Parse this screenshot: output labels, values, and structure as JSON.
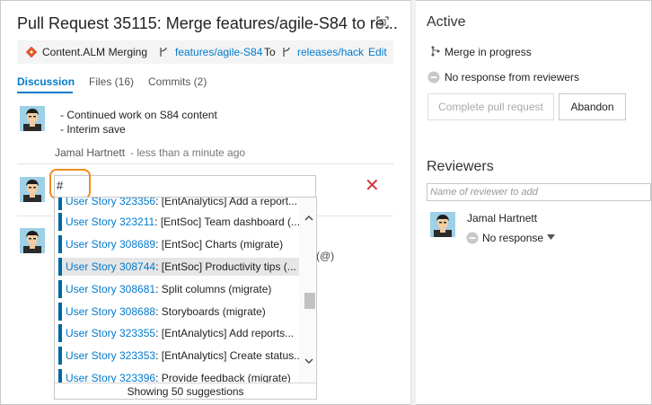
{
  "header": {
    "title": "Pull Request 35115: Merge features/agile-S84 to re...",
    "repo": "Content.ALM",
    "merging_label": ": Merging",
    "source_branch": "features/agile-S84",
    "to_label": "To",
    "target_branch": "releases/hack",
    "edit_label": "Edit"
  },
  "tabs": [
    {
      "label": "Discussion"
    },
    {
      "label": "Files (16)"
    },
    {
      "label": "Commits (2)"
    }
  ],
  "comment": {
    "lines": [
      "- Continued work on S84 content",
      "- Interim save"
    ],
    "author": "Jamal Hartnett",
    "time": "- less than a minute ago"
  },
  "reply": {
    "value": "#",
    "mention_hint": "(@)"
  },
  "suggestions": {
    "items": [
      {
        "id": "User Story 323356",
        "title": ": [EntAnalytics] Add a report..."
      },
      {
        "id": "User Story 323211",
        "title": ": [EntSoc] Team dashboard (..."
      },
      {
        "id": "User Story 308689",
        "title": ": [EntSoc] Charts (migrate)"
      },
      {
        "id": "User Story 308744",
        "title": ": [EntSoc] Productivity tips (..."
      },
      {
        "id": "User Story 308681",
        "title": ": Split columns (migrate)"
      },
      {
        "id": "User Story 308688",
        "title": ": Storyboards (migrate)"
      },
      {
        "id": "User Story 323355",
        "title": ": [EntAnalytics] Add reports..."
      },
      {
        "id": "User Story 323353",
        "title": ": [EntAnalytics] Create status..."
      },
      {
        "id": "User Story 323396",
        "title": ": Provide feedback (migrate)"
      }
    ],
    "footer": "Showing 50 suggestions"
  },
  "active": {
    "title": "Active",
    "merge_status": "Merge in progress",
    "review_status": "No response from reviewers",
    "complete_button": "Complete pull request",
    "abandon_button": "Abandon"
  },
  "reviewers": {
    "title": "Reviewers",
    "placeholder": "Name of reviewer to add",
    "list": [
      {
        "name": "Jamal Hartnett",
        "vote": "No response"
      }
    ]
  },
  "colors": {
    "accent": "#007acc",
    "focus": "#f08c1e",
    "delete": "#d13438",
    "workitem_bar": "#00669e"
  }
}
